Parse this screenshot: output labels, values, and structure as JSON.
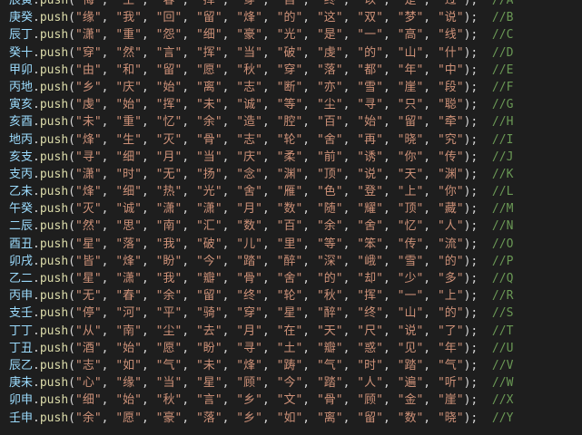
{
  "editor": {
    "method": "push",
    "lines": [
      {
        "var": "辰寅",
        "items": [
          "悔",
          "土",
          "春",
          "挥",
          "穿",
          "自",
          "终",
          "以",
          "是",
          "过"
        ],
        "comment": "//A"
      },
      {
        "var": "庚癸",
        "items": [
          "缘",
          "我",
          "回",
          "留",
          "烽",
          "的",
          "这",
          "双",
          "梦",
          "说"
        ],
        "comment": "//B"
      },
      {
        "var": "辰丁",
        "items": [
          "潇",
          "重",
          "怨",
          "细",
          "豪",
          "光",
          "是",
          "一",
          "高",
          "线"
        ],
        "comment": "//C"
      },
      {
        "var": "癸十",
        "items": [
          "穿",
          "然",
          "言",
          "挥",
          "当",
          "破",
          "虔",
          "的",
          "山",
          "什"
        ],
        "comment": "//D"
      },
      {
        "var": "甲卯",
        "items": [
          "由",
          "和",
          "留",
          "愿",
          "秋",
          "穿",
          "落",
          "都",
          "年",
          "中"
        ],
        "comment": "//E"
      },
      {
        "var": "丙地",
        "items": [
          "乡",
          "庆",
          "始",
          "离",
          "志",
          "断",
          "亦",
          "雪",
          "崖",
          "段"
        ],
        "comment": "//F"
      },
      {
        "var": "寅亥",
        "items": [
          "虔",
          "始",
          "挥",
          "未",
          "诚",
          "等",
          "尘",
          "寻",
          "只",
          "聪"
        ],
        "comment": "//G"
      },
      {
        "var": "亥酉",
        "items": [
          "未",
          "重",
          "忆",
          "余",
          "造",
          "腔",
          "百",
          "始",
          "留",
          "牵"
        ],
        "comment": "//H"
      },
      {
        "var": "地丙",
        "items": [
          "烽",
          "生",
          "灭",
          "骨",
          "志",
          "轮",
          "舍",
          "再",
          "晓",
          "究"
        ],
        "comment": "//I"
      },
      {
        "var": "亥支",
        "items": [
          "寻",
          "细",
          "月",
          "当",
          "庆",
          "柔",
          "前",
          "诱",
          "你",
          "传"
        ],
        "comment": "//J"
      },
      {
        "var": "支丙",
        "items": [
          "潇",
          "时",
          "无",
          "扬",
          "念",
          "渊",
          "顶",
          "说",
          "天",
          "渊"
        ],
        "comment": "//K"
      },
      {
        "var": "乙未",
        "items": [
          "烽",
          "细",
          "热",
          "光",
          "舍",
          "雁",
          "色",
          "登",
          "上",
          "你"
        ],
        "comment": "//L"
      },
      {
        "var": "午癸",
        "items": [
          "灭",
          "诚",
          "潇",
          "潇",
          "月",
          "数",
          "随",
          "耀",
          "顶",
          "藏"
        ],
        "comment": "//M"
      },
      {
        "var": "二辰",
        "items": [
          "然",
          "思",
          "南",
          "汇",
          "数",
          "百",
          "余",
          "舍",
          "忆",
          "人"
        ],
        "comment": "//N"
      },
      {
        "var": "酉丑",
        "items": [
          "星",
          "落",
          "我",
          "破",
          "儿",
          "里",
          "等",
          "笨",
          "传",
          "流"
        ],
        "comment": "//O"
      },
      {
        "var": "卯戌",
        "items": [
          "皆",
          "烽",
          "盼",
          "今",
          "踏",
          "醉",
          "深",
          "峨",
          "雪",
          "的"
        ],
        "comment": "//P"
      },
      {
        "var": "乙二",
        "items": [
          "星",
          "潇",
          "我",
          "瓣",
          "骨",
          "舍",
          "的",
          "却",
          "少",
          "多"
        ],
        "comment": "//Q"
      },
      {
        "var": "丙申",
        "items": [
          "无",
          "春",
          "余",
          "留",
          "终",
          "轮",
          "秋",
          "挥",
          "一",
          "上"
        ],
        "comment": "//R"
      },
      {
        "var": "支壬",
        "items": [
          "停",
          "河",
          "平",
          "骑",
          "穿",
          "星",
          "醉",
          "终",
          "山",
          "的"
        ],
        "comment": "//S"
      },
      {
        "var": "丁丁",
        "items": [
          "从",
          "南",
          "尘",
          "去",
          "月",
          "在",
          "天",
          "尺",
          "说",
          "了"
        ],
        "comment": "//T"
      },
      {
        "var": "丁丑",
        "items": [
          "酒",
          "始",
          "愿",
          "盼",
          "寻",
          "土",
          "瓣",
          "惑",
          "见",
          "年"
        ],
        "comment": "//U"
      },
      {
        "var": "辰乙",
        "items": [
          "志",
          "如",
          "气",
          "未",
          "烽",
          "踌",
          "气",
          "时",
          "踏",
          "气"
        ],
        "comment": "//V"
      },
      {
        "var": "庚未",
        "items": [
          "心",
          "缘",
          "当",
          "星",
          "顾",
          "今",
          "踏",
          "人",
          "遍",
          "听"
        ],
        "comment": "//W"
      },
      {
        "var": "卯申",
        "items": [
          "细",
          "始",
          "秋",
          "言",
          "乡",
          "文",
          "骨",
          "顾",
          "金",
          "崖"
        ],
        "comment": "//X"
      },
      {
        "var": "壬申",
        "items": [
          "余",
          "愿",
          "豪",
          "落",
          "乡",
          "如",
          "离",
          "留",
          "数",
          "晓"
        ],
        "comment": "//Y"
      }
    ]
  }
}
